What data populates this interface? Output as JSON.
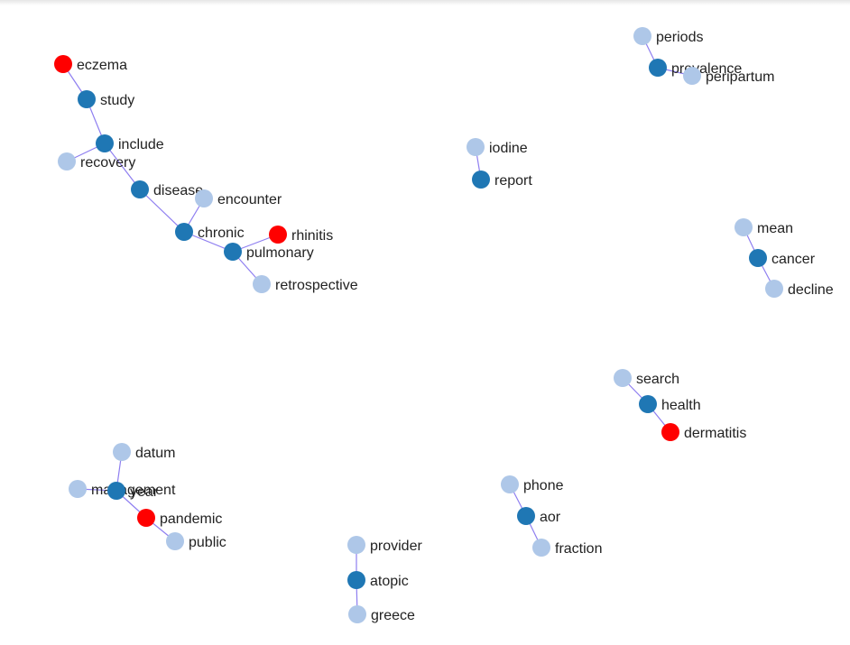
{
  "colors": {
    "edge": "#7b68ee",
    "group_colors": {
      "center": "#1f77b4",
      "neighbor": "#aec7e8",
      "condition": "#ff0000"
    }
  },
  "nodes": [
    {
      "id": "eczema",
      "label": "eczema",
      "group": "condition"
    },
    {
      "id": "study",
      "label": "study",
      "group": "center"
    },
    {
      "id": "include",
      "label": "include",
      "group": "center"
    },
    {
      "id": "recovery",
      "label": "recovery",
      "group": "neighbor"
    },
    {
      "id": "disease",
      "label": "disease",
      "group": "center"
    },
    {
      "id": "encounter",
      "label": "encounter",
      "group": "neighbor"
    },
    {
      "id": "chronic",
      "label": "chronic",
      "group": "center"
    },
    {
      "id": "rhinitis",
      "label": "rhinitis",
      "group": "condition"
    },
    {
      "id": "pulmonary",
      "label": "pulmonary",
      "group": "center"
    },
    {
      "id": "retrospective",
      "label": "retrospective",
      "group": "neighbor"
    },
    {
      "id": "periods",
      "label": "periods",
      "group": "neighbor"
    },
    {
      "id": "prevalence",
      "label": "prevalence",
      "group": "center"
    },
    {
      "id": "peripartum",
      "label": "peripartum",
      "group": "neighbor"
    },
    {
      "id": "iodine",
      "label": "iodine",
      "group": "neighbor"
    },
    {
      "id": "report",
      "label": "report",
      "group": "center"
    },
    {
      "id": "mean",
      "label": "mean",
      "group": "neighbor"
    },
    {
      "id": "cancer",
      "label": "cancer",
      "group": "center"
    },
    {
      "id": "decline",
      "label": "decline",
      "group": "neighbor"
    },
    {
      "id": "search",
      "label": "search",
      "group": "neighbor"
    },
    {
      "id": "health",
      "label": "health",
      "group": "center"
    },
    {
      "id": "dermatitis",
      "label": "dermatitis",
      "group": "condition"
    },
    {
      "id": "datum",
      "label": "datum",
      "group": "neighbor"
    },
    {
      "id": "management",
      "label": "management",
      "group": "neighbor"
    },
    {
      "id": "year",
      "label": "year",
      "group": "center"
    },
    {
      "id": "pandemic",
      "label": "pandemic",
      "group": "condition"
    },
    {
      "id": "public",
      "label": "public",
      "group": "neighbor"
    },
    {
      "id": "phone",
      "label": "phone",
      "group": "neighbor"
    },
    {
      "id": "aor",
      "label": "aor",
      "group": "center"
    },
    {
      "id": "fraction",
      "label": "fraction",
      "group": "neighbor"
    },
    {
      "id": "provider",
      "label": "provider",
      "group": "neighbor"
    },
    {
      "id": "atopic",
      "label": "atopic",
      "group": "center"
    },
    {
      "id": "greece",
      "label": "greece",
      "group": "neighbor"
    }
  ],
  "edges": [
    [
      "eczema",
      "study"
    ],
    [
      "study",
      "include"
    ],
    [
      "include",
      "recovery"
    ],
    [
      "include",
      "disease"
    ],
    [
      "disease",
      "chronic"
    ],
    [
      "chronic",
      "encounter"
    ],
    [
      "chronic",
      "pulmonary"
    ],
    [
      "pulmonary",
      "rhinitis"
    ],
    [
      "pulmonary",
      "retrospective"
    ],
    [
      "periods",
      "prevalence"
    ],
    [
      "prevalence",
      "peripartum"
    ],
    [
      "iodine",
      "report"
    ],
    [
      "mean",
      "cancer"
    ],
    [
      "cancer",
      "decline"
    ],
    [
      "search",
      "health"
    ],
    [
      "health",
      "dermatitis"
    ],
    [
      "datum",
      "year"
    ],
    [
      "management",
      "year"
    ],
    [
      "year",
      "pandemic"
    ],
    [
      "pandemic",
      "public"
    ],
    [
      "phone",
      "aor"
    ],
    [
      "aor",
      "fraction"
    ],
    [
      "provider",
      "atopic"
    ],
    [
      "atopic",
      "greece"
    ]
  ]
}
